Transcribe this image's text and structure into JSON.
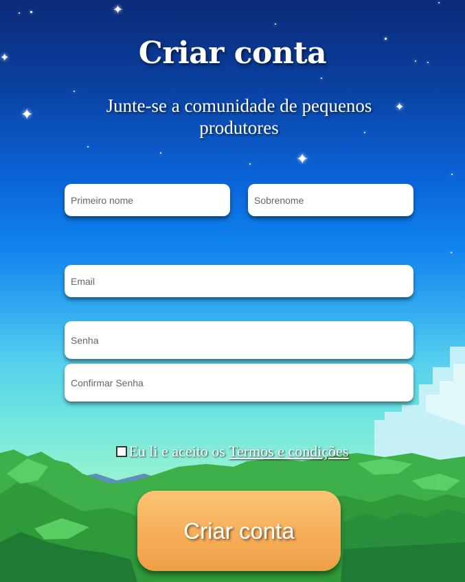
{
  "header": {
    "title": "Criar conta",
    "subtitle": "Junte-se a comunidade de pequenos produtores"
  },
  "form": {
    "first_name": {
      "placeholder": "Primeiro nome",
      "value": ""
    },
    "last_name": {
      "placeholder": "Sobrenome",
      "value": ""
    },
    "email": {
      "placeholder": "Email",
      "value": ""
    },
    "password": {
      "placeholder": "Senha",
      "value": ""
    },
    "confirm_password": {
      "placeholder": "Confirmar Senha",
      "value": ""
    },
    "terms": {
      "checked": false,
      "text": "Eu li e aceito os ",
      "link": "Termos e condições"
    },
    "submit_label": "Criar conta"
  },
  "colors": {
    "sky_top": "#0b2a78",
    "sky_bottom": "#a6f3cf",
    "button": "#f6ae5a",
    "mountains": "#2f9a3a"
  }
}
